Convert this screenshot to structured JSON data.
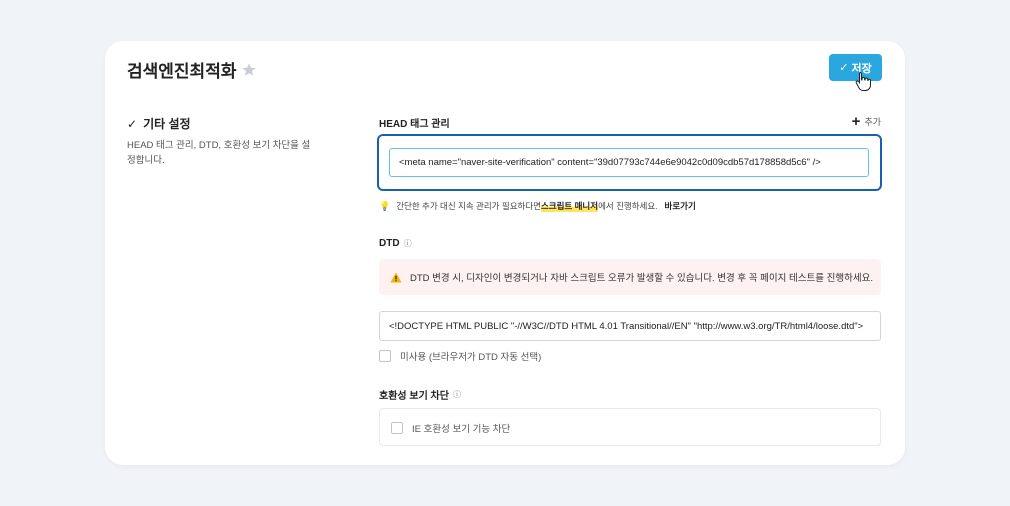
{
  "header": {
    "title": "검색엔진최적화",
    "save_label": "저장"
  },
  "sidebar": {
    "title": "기타 설정",
    "description": "HEAD 태그 관리, DTD, 호환성 보기 차단을 설정합니다."
  },
  "head_tag": {
    "label": "HEAD 태그 관리",
    "add_label": "추가",
    "value": "<meta name=\"naver-site-verification\" content=\"39d07793c744e6e9042c0d09cdb57d178858d5c6\" />",
    "tip_prefix": "간단한 추가 대신 지속 관리가 필요하다면 ",
    "tip_highlight": "스크립트 매니저",
    "tip_suffix": "에서 진행하세요.",
    "tip_link": "바로가기"
  },
  "dtd": {
    "label": "DTD",
    "warning": "DTD 변경 시, 디자인이 변경되거나 자바 스크립트 오류가 발생할 수 있습니다. 변경 후 꼭 페이지 테스트를 진행하세요.",
    "value": "<!DOCTYPE HTML PUBLIC \"-//W3C//DTD HTML 4.01 Transitional//EN\" \"http://www.w3.org/TR/html4/loose.dtd\">",
    "unused_label": "미사용 (브라우저가 DTD 자동 선택)"
  },
  "compat": {
    "label": "호환성 보기 차단",
    "ie_label": "IE 호환성 보기 기능 차단"
  },
  "colors": {
    "accent": "#2aa7df",
    "focus_border": "#1a5fb4",
    "warning_bg": "#fdf1f1"
  }
}
